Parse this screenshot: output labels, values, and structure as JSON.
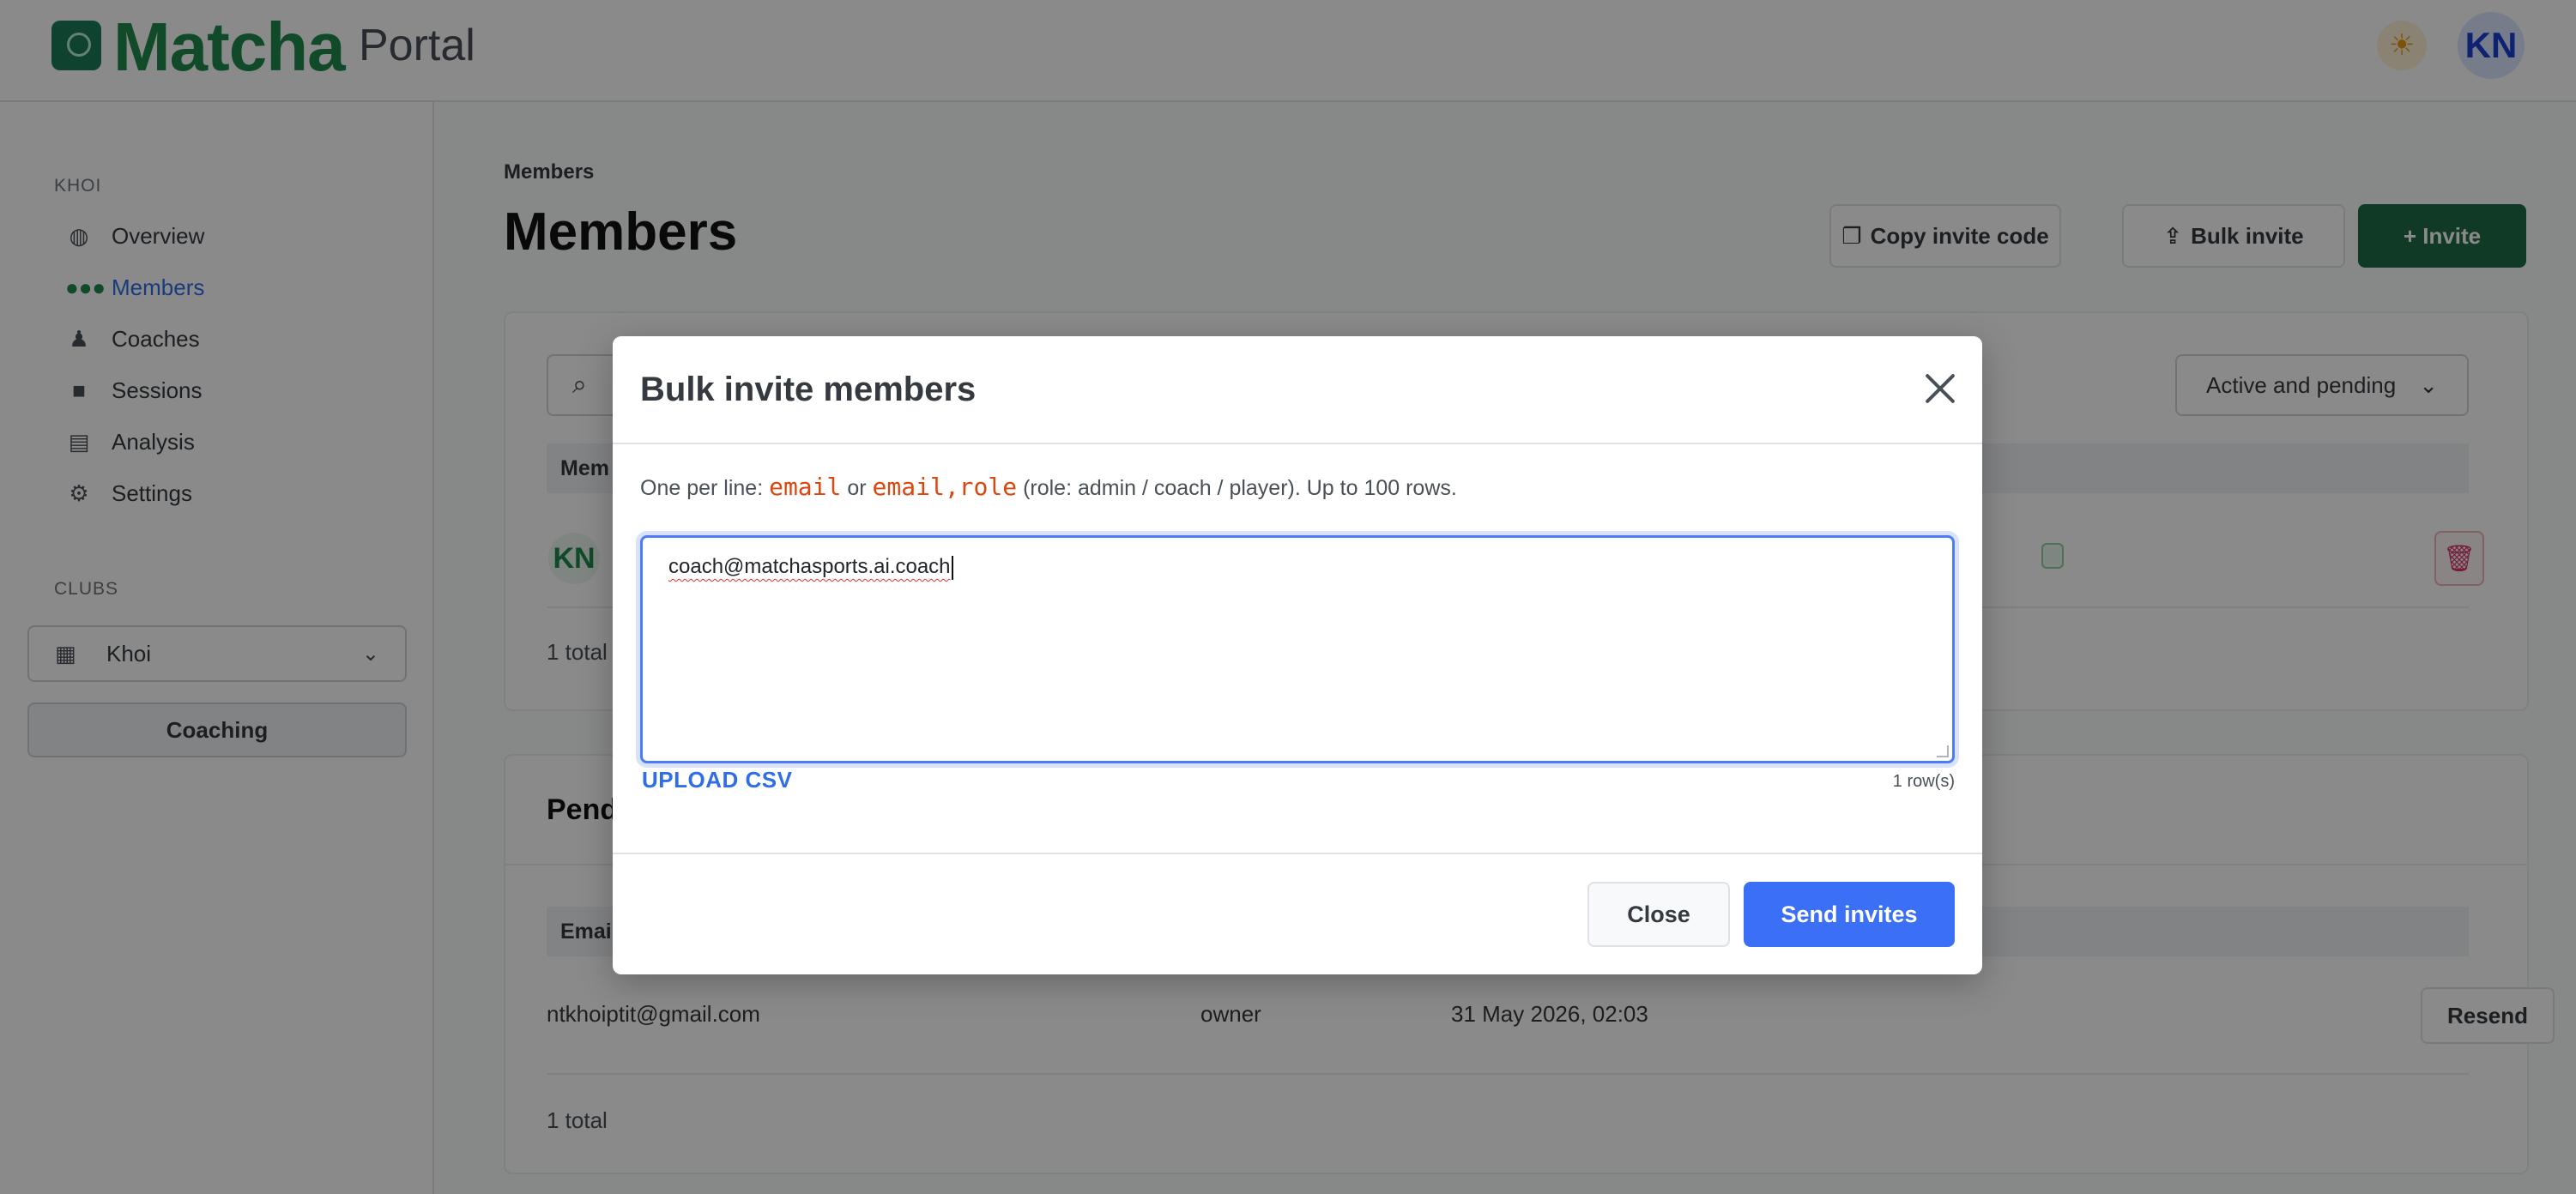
{
  "header": {
    "brand": "Matcha",
    "brand_sub": "Portal",
    "avatar_initials": "KN",
    "theme_icon": "sun-icon"
  },
  "sidebar": {
    "section_label": "KHOI",
    "items": [
      {
        "label": "Overview",
        "icon": "globe-icon"
      },
      {
        "label": "Members",
        "icon": "users-icon",
        "active": true
      },
      {
        "label": "Coaches",
        "icon": "coach-icon"
      },
      {
        "label": "Sessions",
        "icon": "video-icon"
      },
      {
        "label": "Analysis",
        "icon": "clipboard-icon"
      },
      {
        "label": "Settings",
        "icon": "gear-icon"
      }
    ],
    "clubs_label": "CLUBS",
    "club_select_value": "Khoi",
    "coaching_button": "Coaching"
  },
  "main": {
    "breadcrumb": "Members",
    "title": "Members",
    "actions": {
      "copy_invite_code": "Copy invite code",
      "bulk_invite": "Bulk invite",
      "invite": "+ Invite"
    },
    "members_card": {
      "filter_value": "Active and pending",
      "header_first_col": "Mem",
      "member_initials": "KN",
      "total": "1 total"
    },
    "pending_card": {
      "title": "Pend",
      "header_first_col": "Emai",
      "rows": [
        {
          "email": "ntkhoiptit@gmail.com",
          "role": "owner",
          "date": "31 May 2026, 02:03",
          "action": "Resend"
        }
      ],
      "total": "1 total"
    }
  },
  "modal": {
    "title": "Bulk invite members",
    "hint_prefix": "One per line:",
    "hint_code1": "email",
    "hint_or": "or",
    "hint_code2": "email,role",
    "hint_suffix": "(role: admin / coach / player). Up to 100 rows.",
    "textarea_value": "coach@matchasports.ai.coach",
    "upload_csv": "UPLOAD CSV",
    "row_count": "1 row(s)",
    "close_button": "Close",
    "send_button": "Send invites"
  },
  "colors": {
    "brand_green": "#1f8a4c",
    "primary_blue": "#3b6ff6",
    "invite_green": "#1f6b45",
    "hint_code": "#d9480f"
  }
}
